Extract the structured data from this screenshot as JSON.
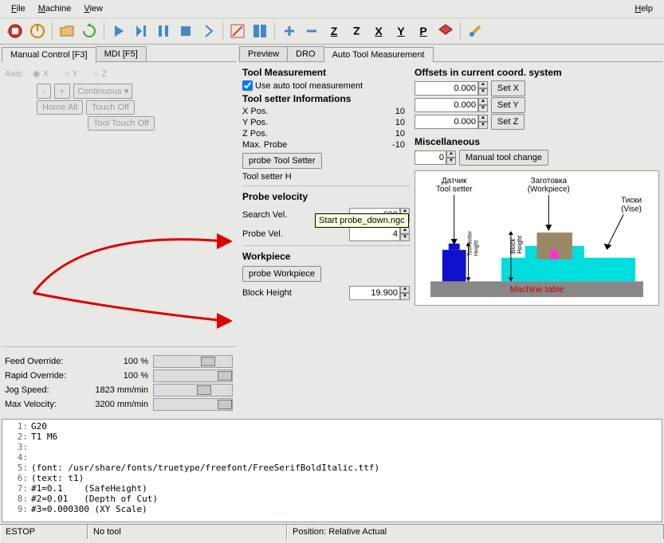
{
  "menubar": {
    "file": "File",
    "machine": "Machine",
    "view": "View",
    "help": "Help"
  },
  "left_tabs": {
    "manual": "Manual Control [F3]",
    "mdi": "MDI [F5]"
  },
  "axis_panel": {
    "axis_label": "Axis:",
    "x": "X",
    "y": "Y",
    "z": "Z",
    "minus": "-",
    "plus": "+",
    "continuous": "Continuous",
    "home_all": "Home All",
    "touch_off": "Touch Off",
    "tool_touch_off": "Tool Touch Off"
  },
  "sliders": {
    "feed_label": "Feed Override:",
    "feed_val": "100 %",
    "rapid_label": "Rapid Override:",
    "rapid_val": "100 %",
    "jog_label": "Jog Speed:",
    "jog_val": "1823 mm/min",
    "max_label": "Max Velocity:",
    "max_val": "3200 mm/min"
  },
  "right_tabs": {
    "preview": "Preview",
    "dro": "DRO",
    "atm": "Auto Tool Measurement"
  },
  "tm": {
    "title": "Tool Measurement",
    "auto_label": "Use auto tool measurement",
    "tsi_title": "Tool setter Informations",
    "xpos_l": "X Pos.",
    "xpos_v": "10",
    "ypos_l": "Y Pos.",
    "ypos_v": "10",
    "zpos_l": "Z Pos.",
    "zpos_v": "10",
    "maxp_l": "Max. Probe",
    "maxp_v": "-10",
    "probe_ts_btn": "probe Tool Setter",
    "tsh_l": "Tool setter H",
    "pv_title": "Probe velocity",
    "search_l": "Search Vel.",
    "search_v": "600",
    "probe_l": "Probe Vel.",
    "probe_v": "4",
    "wp_title": "Workpiece",
    "probe_wp_btn": "probe Workpiece",
    "bh_l": "Block Height",
    "bh_v": "19.900"
  },
  "tooltip": "Start probe_down.ngc",
  "offsets": {
    "title": "Offsets in current coord. system",
    "v0": "0.000",
    "setx": "Set X",
    "v1": "0.000",
    "sety": "Set Y",
    "v2": "0.000",
    "setz": "Set Z",
    "misc_title": "Miscellaneous",
    "mv": "0",
    "mtc": "Manual tool change"
  },
  "diagram": {
    "sensor": "Датчик",
    "toolsetter": "Tool setter",
    "workpiece": "Заготовка",
    "workpiece_en": "(Workpiece)",
    "vise": "Тиски",
    "vise_en": "(Vise)",
    "tsh": "Tool setter",
    "tshh": "Height",
    "bh1": "Block",
    "bh2": "Height",
    "table": "Machine table"
  },
  "gcode": [
    "G20",
    "T1 M6",
    "",
    "",
    "(font: /usr/share/fonts/truetype/freefont/FreeSerifBoldItalic.ttf)",
    "(text: t1)",
    "#1=0.1    (SafeHeight)",
    "#2=0.01   (Depth of Cut)",
    "#3=0.000300 (XY Scale)"
  ],
  "status": {
    "estop": "ESTOP",
    "notool": "No tool",
    "pos": "Position: Relative Actual"
  }
}
